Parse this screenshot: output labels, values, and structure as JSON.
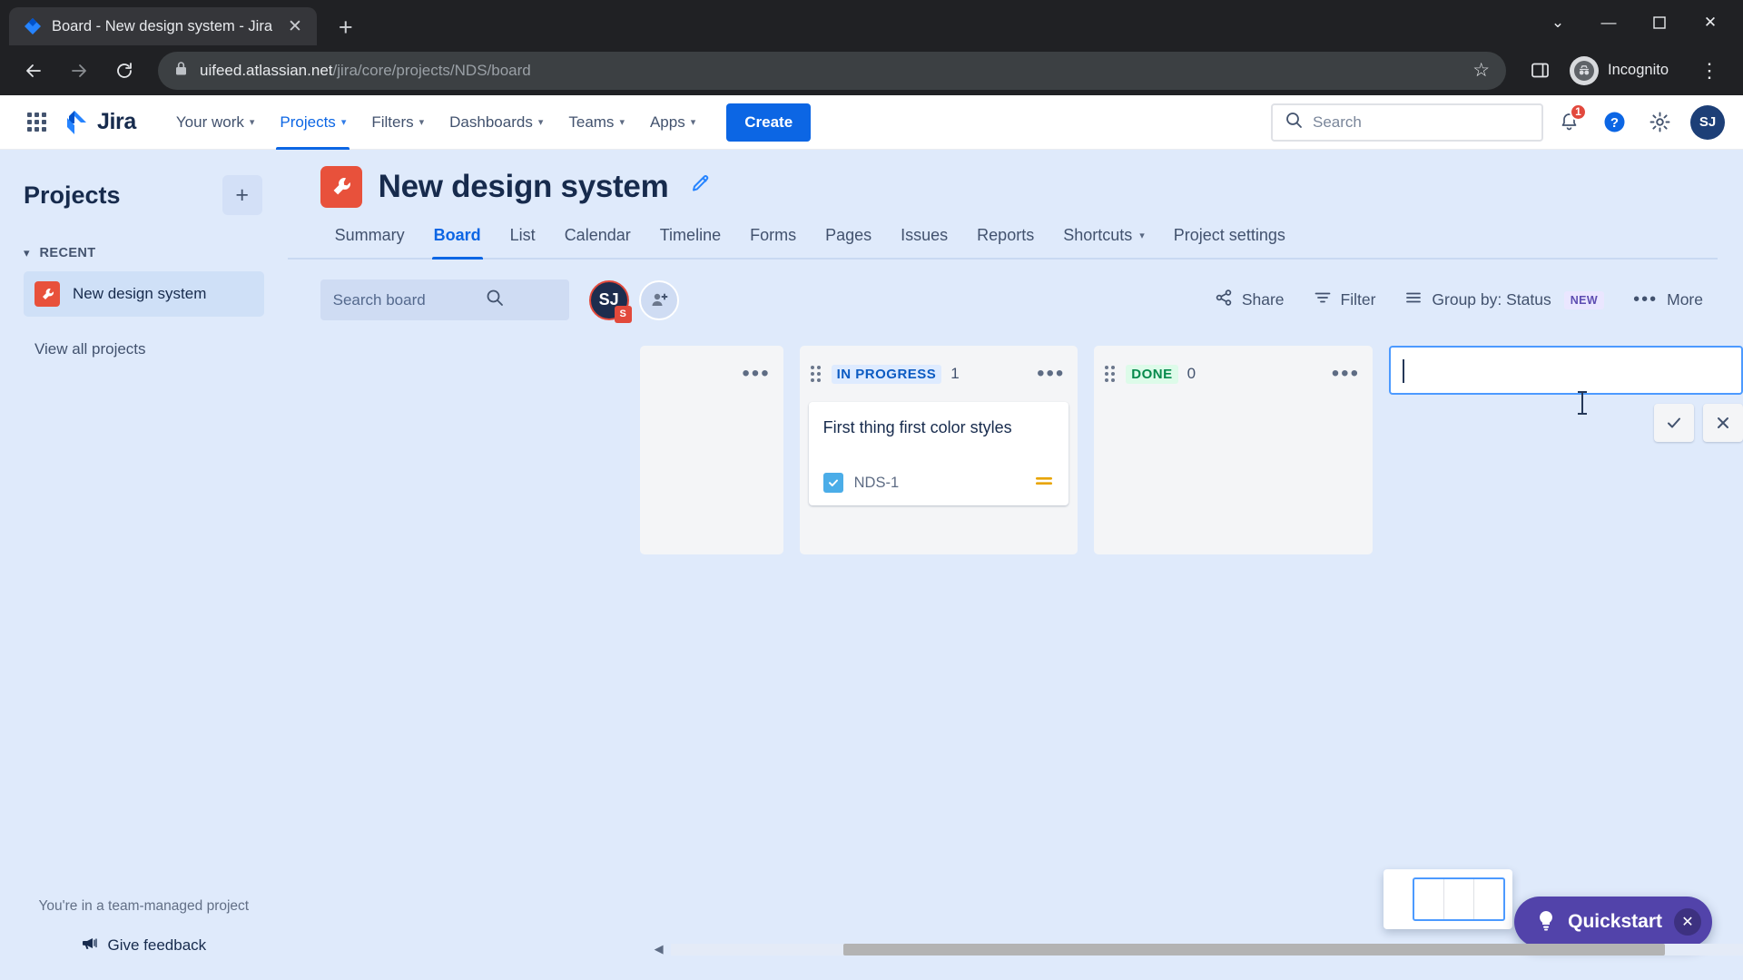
{
  "browser": {
    "tab": {
      "title": "Board - New design system - Jira",
      "favicon": "jira-diamond-icon",
      "close_label": "✕"
    },
    "new_tab_label": "+",
    "window_controls": {
      "minimize_chevron": "⌄",
      "minimize": "—",
      "maximize": "❐",
      "close": "✕"
    },
    "nav": {
      "back": "←",
      "forward": "→",
      "reload": "↻"
    },
    "omnibox": {
      "lock_icon": "lock-icon",
      "url_domain": "uifeed.atlassian.net",
      "url_path": "/jira/core/projects/NDS/board",
      "star": "☆",
      "sidepanel": "▧",
      "menu": "⋮"
    },
    "incognito": {
      "label": "Incognito"
    }
  },
  "jira_nav": {
    "app_switcher": "grid-icon",
    "logo_text": "Jira",
    "items": [
      {
        "label": "Your work",
        "has_chevron": true,
        "active": false
      },
      {
        "label": "Projects",
        "has_chevron": true,
        "active": true
      },
      {
        "label": "Filters",
        "has_chevron": true,
        "active": false
      },
      {
        "label": "Dashboards",
        "has_chevron": true,
        "active": false
      },
      {
        "label": "Teams",
        "has_chevron": true,
        "active": false
      },
      {
        "label": "Apps",
        "has_chevron": true,
        "active": false
      }
    ],
    "create_label": "Create",
    "search_placeholder": "Search",
    "notifications_count": "1",
    "help_label": "?",
    "settings_label": "gear",
    "avatar_initials": "SJ"
  },
  "sidebar": {
    "title": "Projects",
    "add_label": "+",
    "section_label": "RECENT",
    "section_chevron": "⌄",
    "items": [
      {
        "label": "New design system",
        "icon": "wrench-icon",
        "active": true
      }
    ],
    "view_all_label": "View all projects",
    "footer_note": "You're in a team-managed project",
    "feedback_label": "Give feedback"
  },
  "project": {
    "title": "New design system",
    "avatar_icon": "wrench-icon",
    "edit_icon": "pencil-icon",
    "tabs": [
      {
        "label": "Summary",
        "active": false,
        "chevron": false
      },
      {
        "label": "Board",
        "active": true,
        "chevron": false
      },
      {
        "label": "List",
        "active": false,
        "chevron": false
      },
      {
        "label": "Calendar",
        "active": false,
        "chevron": false
      },
      {
        "label": "Timeline",
        "active": false,
        "chevron": false
      },
      {
        "label": "Forms",
        "active": false,
        "chevron": false
      },
      {
        "label": "Pages",
        "active": false,
        "chevron": false
      },
      {
        "label": "Issues",
        "active": false,
        "chevron": false
      },
      {
        "label": "Reports",
        "active": false,
        "chevron": false
      },
      {
        "label": "Shortcuts",
        "active": false,
        "chevron": true
      },
      {
        "label": "Project settings",
        "active": false,
        "chevron": false
      }
    ]
  },
  "board_toolbar": {
    "search_placeholder": "Search board",
    "search_icon": "search-icon",
    "avatar_initials": "SJ",
    "avatar_badge": "S",
    "add_people_icon": "add-person-icon",
    "share_label": "Share",
    "filter_label": "Filter",
    "groupby_label": "Group by: Status",
    "groupby_badge": "NEW",
    "more_label": "More",
    "more_icon": "•••"
  },
  "board": {
    "columns": [
      {
        "name": "",
        "count": "",
        "name_style": "none",
        "menu": "•••",
        "cards": []
      },
      {
        "name": "IN PROGRESS",
        "count": "1",
        "name_style": "inprogress",
        "menu": "•••",
        "cards": [
          {
            "title": "First thing first color styles",
            "key": "NDS-1",
            "type_icon": "task-checkbox-icon",
            "priority_icon": "priority-medium-icon"
          }
        ]
      },
      {
        "name": "DONE",
        "count": "0",
        "name_style": "done",
        "menu": "•••",
        "cards": []
      }
    ],
    "new_column": {
      "value": "",
      "placeholder": "",
      "confirm_label": "✓",
      "cancel_label": "✕"
    }
  },
  "bottom": {
    "scroll_left_arrow": "◀",
    "quickstart_label": "Quickstart",
    "quickstart_icon": "lightbulb-icon",
    "quickstart_close": "✕"
  }
}
